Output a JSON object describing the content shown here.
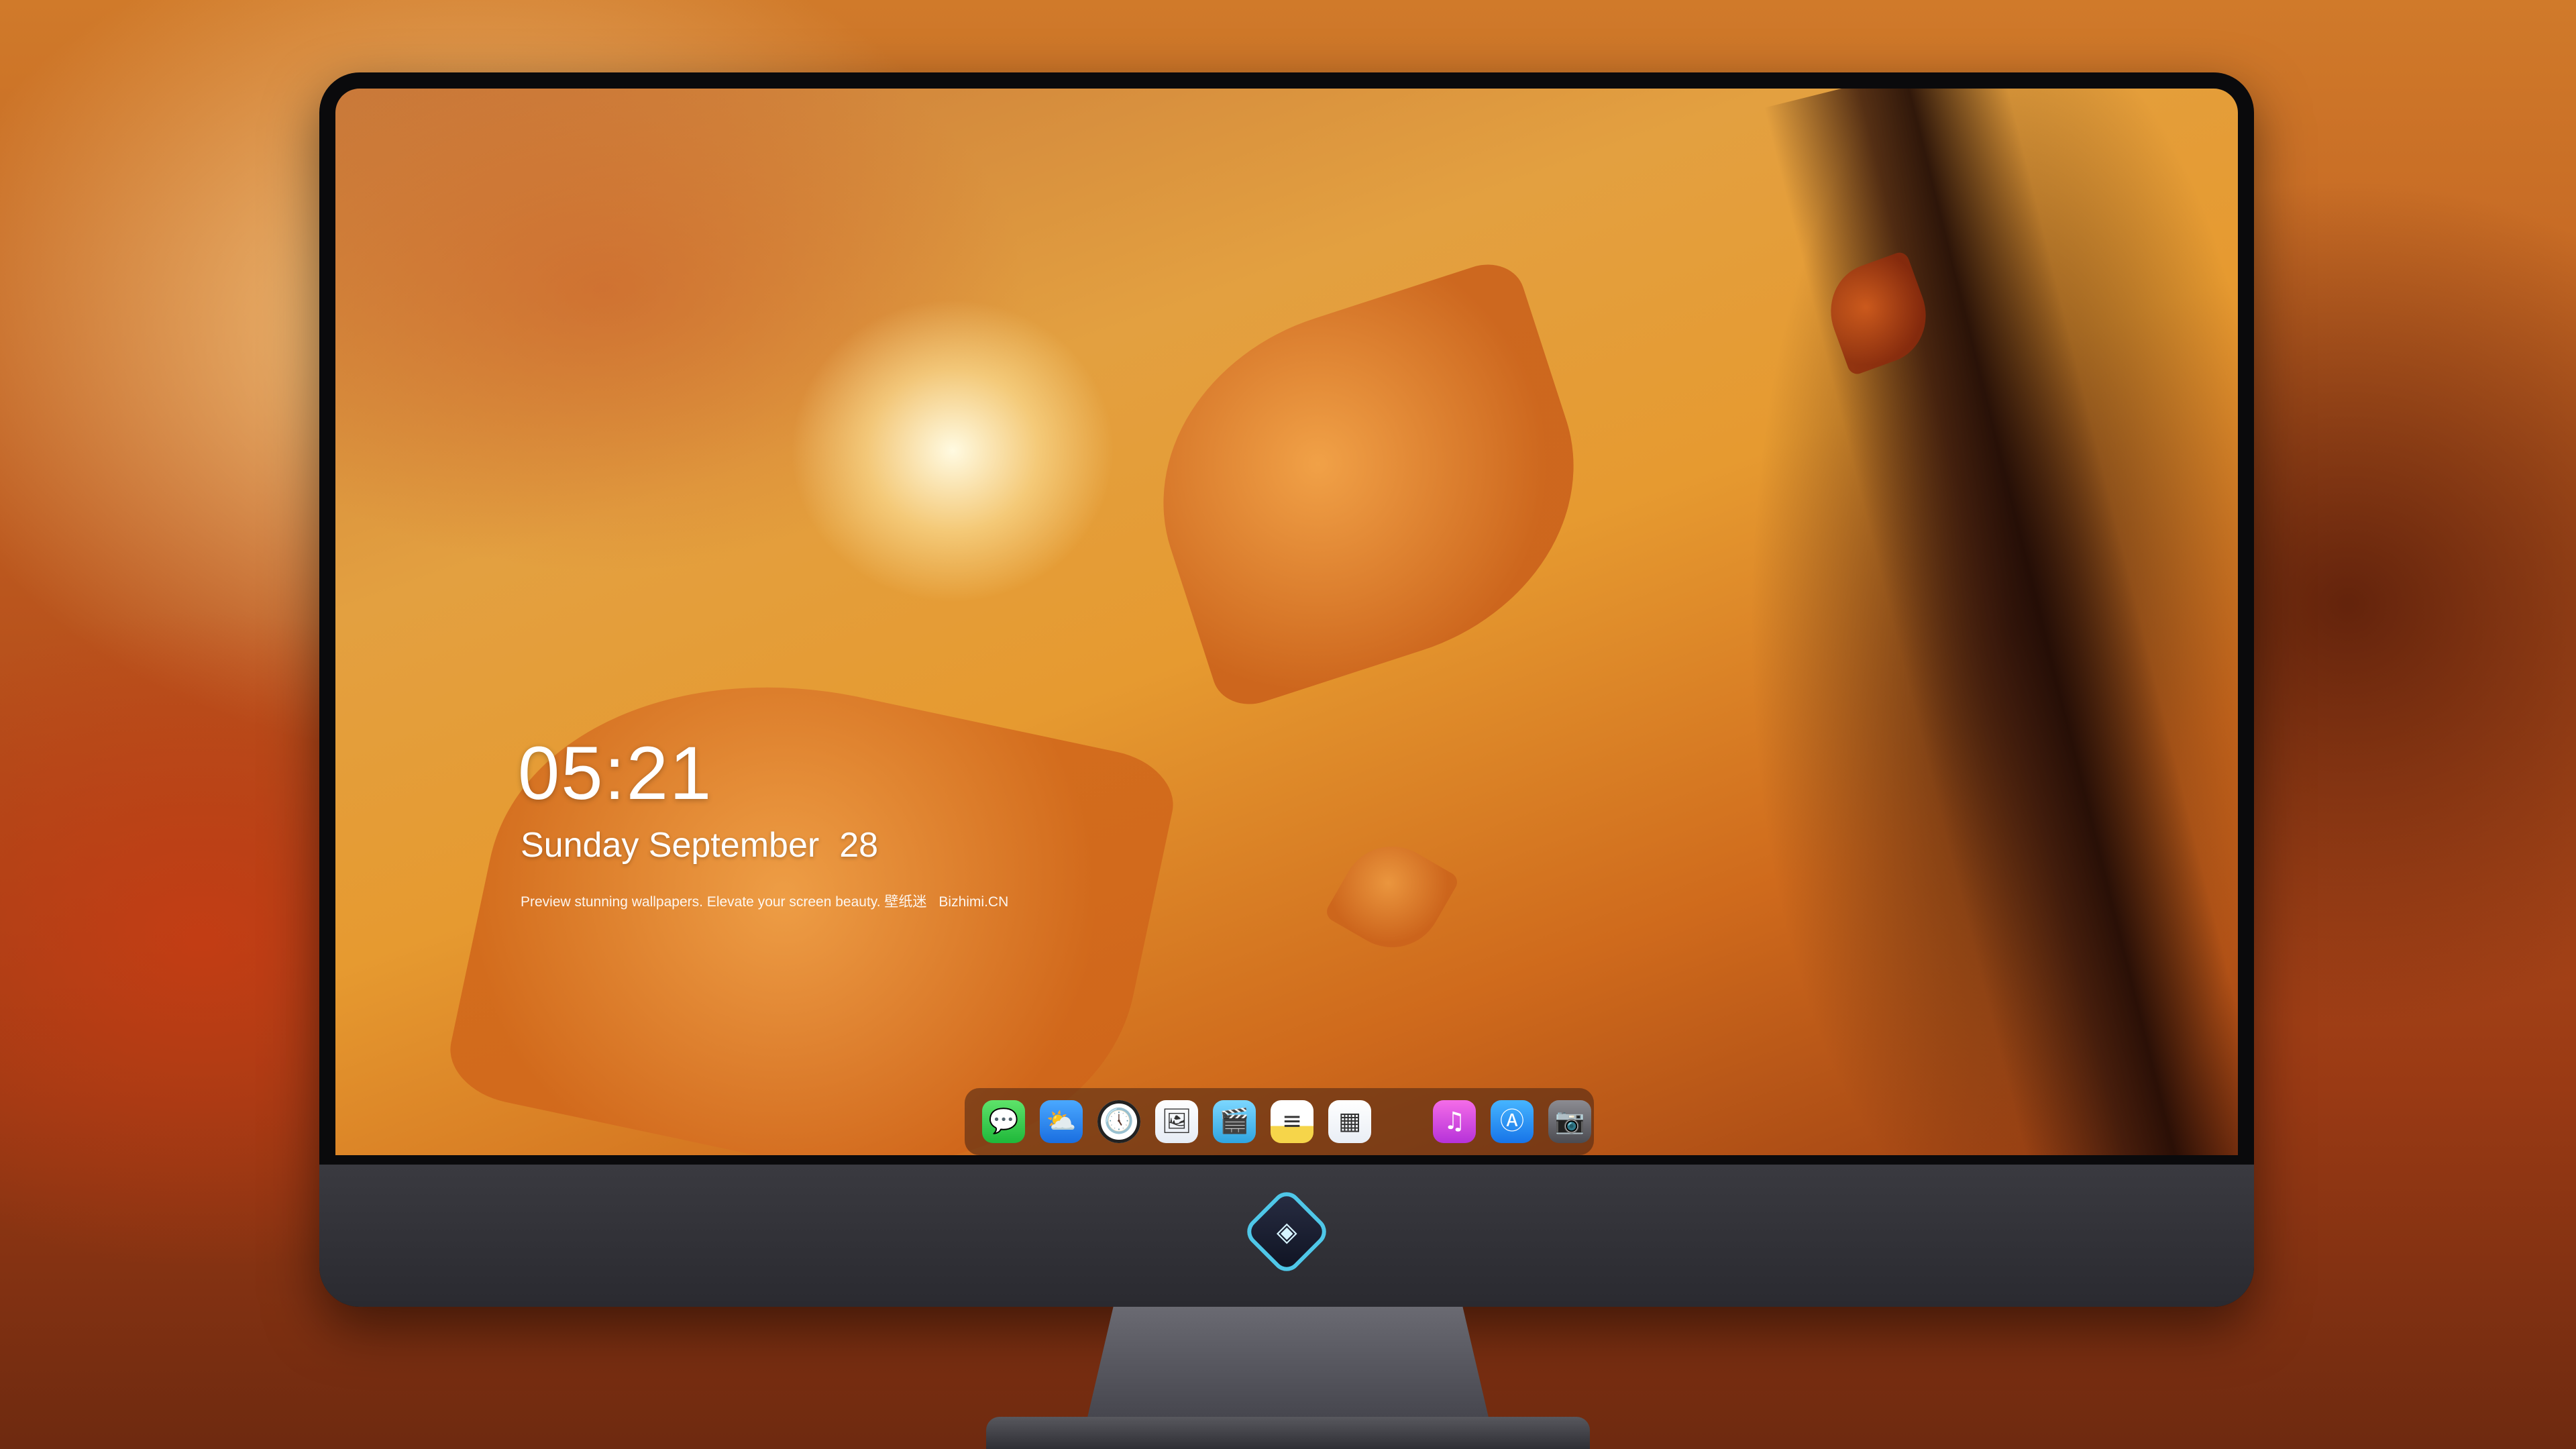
{
  "lockscreen": {
    "time": "05:21",
    "date_weekday_month": "Sunday September",
    "date_day": "28",
    "tagline": "Preview stunning wallpapers. Elevate your screen beauty. 壁纸迷",
    "brand": "Bizhimi.CN"
  },
  "dock": {
    "apps": [
      {
        "name": "messages",
        "icon": "speech-bubble-icon",
        "glyph": "💬"
      },
      {
        "name": "weather",
        "icon": "cloud-sun-icon",
        "glyph": "⛅"
      },
      {
        "name": "clock",
        "icon": "clock-icon",
        "glyph": "🕔"
      },
      {
        "name": "preview",
        "icon": "preview-icon",
        "glyph": "🖼"
      },
      {
        "name": "clips",
        "icon": "clapperboard-icon",
        "glyph": "🎬"
      },
      {
        "name": "notes",
        "icon": "notes-icon",
        "glyph": "≡"
      },
      {
        "name": "photos",
        "icon": "photos-icon",
        "glyph": "▦"
      },
      {
        "name": "music",
        "icon": "music-note-icon",
        "glyph": "♫"
      },
      {
        "name": "app-store",
        "icon": "app-store-icon",
        "glyph": "Ⓐ"
      },
      {
        "name": "camera",
        "icon": "camera-icon",
        "glyph": "📷"
      }
    ]
  },
  "monitor": {
    "logo_icon": "mascot-logo-icon",
    "logo_glyph": "◈"
  },
  "colors": {
    "accent_orange": "#e69a30",
    "bezel": "#0a0a0c",
    "chin": "#3a3a40"
  }
}
